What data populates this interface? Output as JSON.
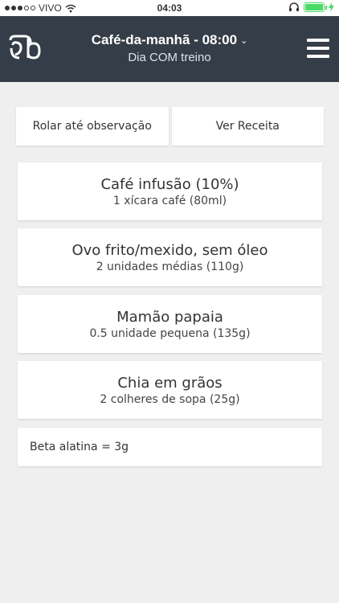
{
  "status_bar": {
    "carrier": "VIVO",
    "time": "04:03",
    "battery_level": 1.0,
    "signal_filled": 3,
    "signal_total": 5
  },
  "header": {
    "meal_title": "Café-da-manhã - 08:00",
    "day_label": "Dia COM treino"
  },
  "actions": {
    "scroll_label": "Rolar até observação",
    "recipe_label": "Ver Receita"
  },
  "foods": [
    {
      "name": "Café infusão (10%)",
      "qty": "1 xícara café (80ml)"
    },
    {
      "name": "Ovo frito/mexido, sem óleo",
      "qty": "2 unidades médias (110g)"
    },
    {
      "name": "Mamão papaia",
      "qty": "0.5 unidade pequena (135g)"
    },
    {
      "name": "Chia em grãos",
      "qty": "2 colheres de sopa (25g)"
    }
  ],
  "note": "Beta alatina = 3g",
  "colors": {
    "header_bg": "#353d48",
    "page_bg": "#efefef",
    "battery": "#4cd964"
  }
}
